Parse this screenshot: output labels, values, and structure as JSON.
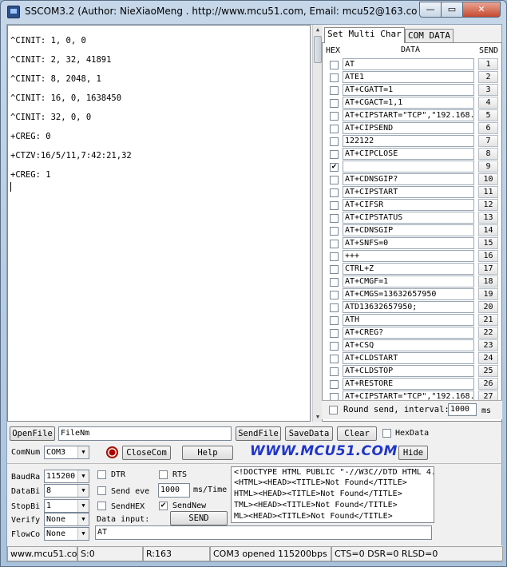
{
  "title": "SSCOM3.2 (Author: NieXiaoMeng .  http://www.mcu51.com,  Email: mcu52@163.co...",
  "window_buttons": {
    "minimize": "—",
    "maximize": "▭",
    "close": "✕"
  },
  "receive_lines": [
    "^CINIT: 1, 0, 0",
    "^CINIT: 2, 32, 41891",
    "^CINIT: 8, 2048, 1",
    "^CINIT: 16, 0, 1638450",
    "^CINIT: 32, 0, 0",
    "+CREG: 0",
    "+CTZV:16/5/11,7:42:21,32",
    "+CREG: 1"
  ],
  "tabs": [
    "Set Multi Char",
    "COM DATA"
  ],
  "multi": {
    "headers": {
      "hex": "HEX",
      "data": "DATA",
      "send": "SEND"
    },
    "rows": [
      {
        "hex": false,
        "data": "AT",
        "num": "1"
      },
      {
        "hex": false,
        "data": "ATE1",
        "num": "2"
      },
      {
        "hex": false,
        "data": "AT+CGATT=1",
        "num": "3"
      },
      {
        "hex": false,
        "data": "AT+CGACT=1,1",
        "num": "4"
      },
      {
        "hex": false,
        "data": "AT+CIPSTART=\"TCP\",\"192.168.",
        "num": "5"
      },
      {
        "hex": false,
        "data": "AT+CIPSEND",
        "num": "6"
      },
      {
        "hex": false,
        "data": "122122",
        "num": "7"
      },
      {
        "hex": false,
        "data": "AT+CIPCLOSE",
        "num": "8"
      },
      {
        "hex": true,
        "data": "",
        "num": "9"
      },
      {
        "hex": false,
        "data": "AT+CDNSGIP?",
        "num": "10"
      },
      {
        "hex": false,
        "data": "AT+CIPSTART",
        "num": "11"
      },
      {
        "hex": false,
        "data": "AT+CIFSR",
        "num": "12"
      },
      {
        "hex": false,
        "data": "AT+CIPSTATUS",
        "num": "13"
      },
      {
        "hex": false,
        "data": "AT+CDNSGIP",
        "num": "14"
      },
      {
        "hex": false,
        "data": "AT+SNFS=0",
        "num": "15"
      },
      {
        "hex": false,
        "data": "+++",
        "num": "16"
      },
      {
        "hex": false,
        "data": "CTRL+Z",
        "num": "17"
      },
      {
        "hex": false,
        "data": "AT+CMGF=1",
        "num": "18"
      },
      {
        "hex": false,
        "data": "AT+CMGS=13632657950",
        "num": "19"
      },
      {
        "hex": false,
        "data": "ATD13632657950;",
        "num": "20"
      },
      {
        "hex": false,
        "data": "ATH",
        "num": "21"
      },
      {
        "hex": false,
        "data": "AT+CREG?",
        "num": "22"
      },
      {
        "hex": false,
        "data": "AT+CSQ",
        "num": "23"
      },
      {
        "hex": false,
        "data": "AT+CLDSTART",
        "num": "24"
      },
      {
        "hex": false,
        "data": "AT+CLDSTOP",
        "num": "25"
      },
      {
        "hex": false,
        "data": "AT+RESTORE",
        "num": "26"
      },
      {
        "hex": false,
        "data": "AT+CIPSTART=\"TCP\",\"192.168.",
        "num": "27"
      }
    ],
    "round_send_label": "Round send, interval:",
    "interval": "1000",
    "interval_unit": "ms"
  },
  "controls": {
    "open_file": "OpenFile",
    "file_name": "FileNm",
    "send_file": "SendFile",
    "save_data": "SaveData",
    "clear": "Clear",
    "hex_data": "HexData",
    "comnum_label": "ComNum",
    "comnum": "COM3",
    "close_com": "CloseCom",
    "help": "Help",
    "url": "WWW.MCU51.COM",
    "hide": "Hide",
    "baud_label": "BaudRa",
    "baud": "115200",
    "databits_label": "DataBi",
    "databits": "8",
    "stopbits_label": "StopBi",
    "stopbits": "1",
    "verify_label": "Verify",
    "verify": "None",
    "flow_label": "FlowCo",
    "flow": "None",
    "dtr": "DTR",
    "rts": "RTS",
    "send_every": "Send eve",
    "period": "1000",
    "period_unit": "ms/Time",
    "send_hex": "SendHEX",
    "send_new": "SendNew",
    "send_new_checked": true,
    "data_input_label": "Data input:",
    "send": "SEND",
    "input_value": "AT"
  },
  "html_lines": [
    "<!DOCTYPE HTML PUBLIC \"-//W3C//DTD HTML 4.",
    "<HTML><HEAD><TITLE>Not Found</TITLE>",
    "HTML><HEAD><TITLE>Not Found</TITLE>",
    "TML><HEAD><TITLE>Not Found</TITLE>",
    "ML><HEAD><TITLE>Not Found</TITLE>"
  ],
  "status": {
    "site": "www.mcu51.com",
    "sent": "S:0",
    "received": "R:163",
    "port": "COM3 opened 115200bps",
    "lines": "CTS=0 DSR=0 RLSD=0"
  }
}
